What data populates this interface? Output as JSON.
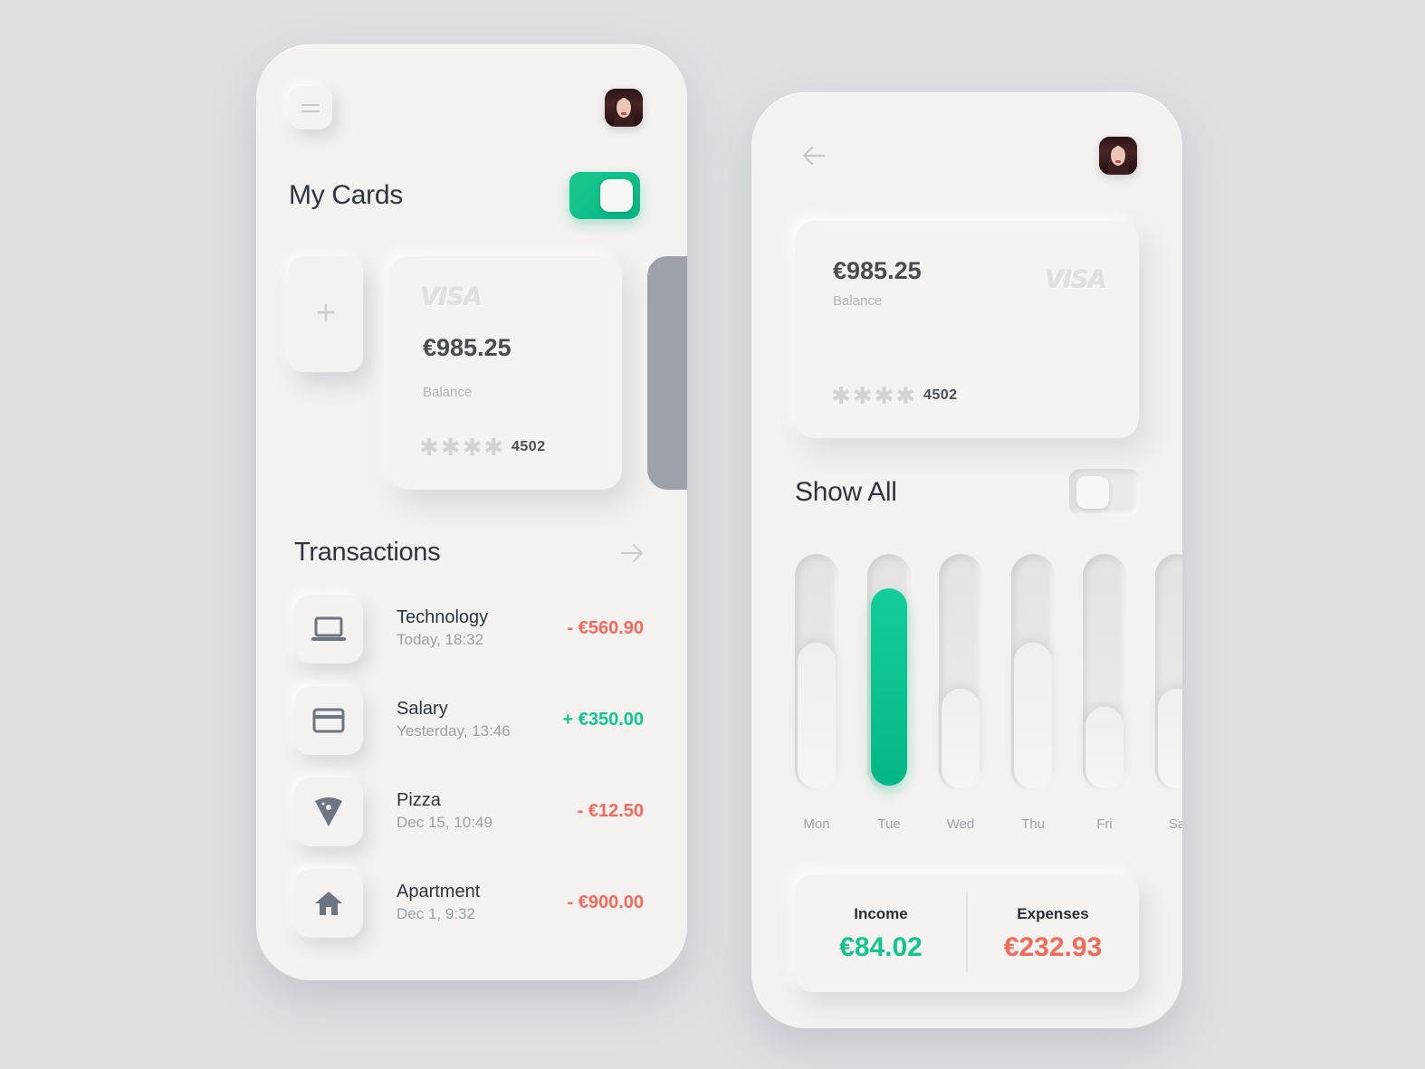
{
  "left": {
    "title": "My Cards",
    "card": {
      "brand": "VISA",
      "amount": "€985.25",
      "balance_label": "Balance",
      "masked": "✱✱✱✱",
      "last4": "4502"
    },
    "add_symbol": "+",
    "transactions_title": "Transactions",
    "transactions": [
      {
        "name": "Technology",
        "date": "Today, 18:32",
        "amount": "- €560.90",
        "icon": "laptop-icon"
      },
      {
        "name": "Salary",
        "date": "Yesterday, 13:46",
        "amount": "+ €350.00",
        "icon": "credit-card-icon"
      },
      {
        "name": "Pizza",
        "date": "Dec 15, 10:49",
        "amount": "- €12.50",
        "icon": "pizza-icon"
      },
      {
        "name": "Apartment",
        "date": "Dec 1, 9:32",
        "amount": "- €900.00",
        "icon": "home-icon"
      }
    ]
  },
  "right": {
    "card": {
      "brand": "VISA",
      "amount": "€985.25",
      "balance_label": "Balance",
      "masked": "✱✱✱✱",
      "last4": "4502"
    },
    "show_all": "Show All",
    "days": [
      {
        "label": "Mon",
        "level": 0.63
      },
      {
        "label": "Tue",
        "level": 0.85,
        "active": true
      },
      {
        "label": "Wed",
        "level": 0.43
      },
      {
        "label": "Thu",
        "level": 0.63
      },
      {
        "label": "Fri",
        "level": 0.35
      },
      {
        "label": "Sa",
        "level": 0.43
      }
    ],
    "income_label": "Income",
    "income_value": "€84.02",
    "expenses_label": "Expenses",
    "expenses_value": "€232.93"
  },
  "colors": {
    "accent": "#12c48e",
    "negative": "#f46a5a",
    "background": "#dfe0e4"
  }
}
